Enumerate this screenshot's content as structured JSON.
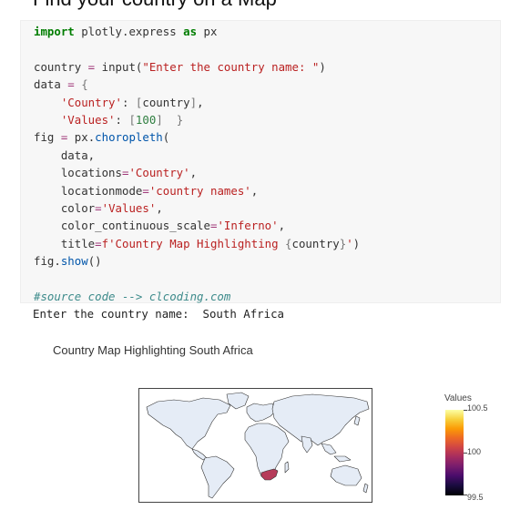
{
  "page_heading": "Find your country on a Map",
  "code": {
    "line1": {
      "kw_import": "import",
      "module": " plotly.express ",
      "kw_as": "as",
      "alias": " px"
    },
    "line3": {
      "var": "country",
      "eq": " = ",
      "fn": "input",
      "open": "(",
      "arg": "\"Enter the country name: \"",
      "close": ")"
    },
    "line4": {
      "var": "data",
      "eq": " = ",
      "brace": "{"
    },
    "line5": {
      "key": "'Country'",
      "colon": ": ",
      "lb": "[",
      "val": "country",
      "rb": "]",
      "comma": ","
    },
    "line6": {
      "key": "'Values'",
      "colon": ": ",
      "lb": "[",
      "val": "100",
      "rb": "]",
      "brace": "  }"
    },
    "line7": {
      "var": "fig",
      "eq": " = ",
      "mod": "px.",
      "fn": "choropleth",
      "open": "("
    },
    "line8": {
      "text": "data,"
    },
    "line9": {
      "param": "locations",
      "eq": "=",
      "val": "'Country'",
      "comma": ","
    },
    "line10": {
      "param": "locationmode",
      "eq": "=",
      "val": "'country names'",
      "comma": ","
    },
    "line11": {
      "param": "color",
      "eq": "=",
      "val": "'Values'",
      "comma": ","
    },
    "line12": {
      "param": "color_continuous_scale",
      "eq": "=",
      "val": "'Inferno'",
      "comma": ","
    },
    "line13": {
      "param": "title",
      "eq": "=",
      "val_a": "f'Country Map Highlighting ",
      "lbrace": "{",
      "val_b": "country",
      "rbrace": "}",
      "val_c": "'",
      "close": ")"
    },
    "line14": {
      "mod": "fig.",
      "fn": "show",
      "parens": "()"
    },
    "line16": {
      "comment": "#source code --> clcoding.com"
    }
  },
  "output": {
    "prompt": "Enter the country name:  ",
    "answer": "South Africa"
  },
  "figure": {
    "title": "Country Map Highlighting South Africa",
    "land_color": "#e5ecf6",
    "highlight_color": "#b63c5a",
    "colorbar": {
      "title": "Values",
      "max_label": "100.5",
      "mid_label": "100",
      "min_label": "99.5",
      "scale": "Inferno"
    }
  }
}
